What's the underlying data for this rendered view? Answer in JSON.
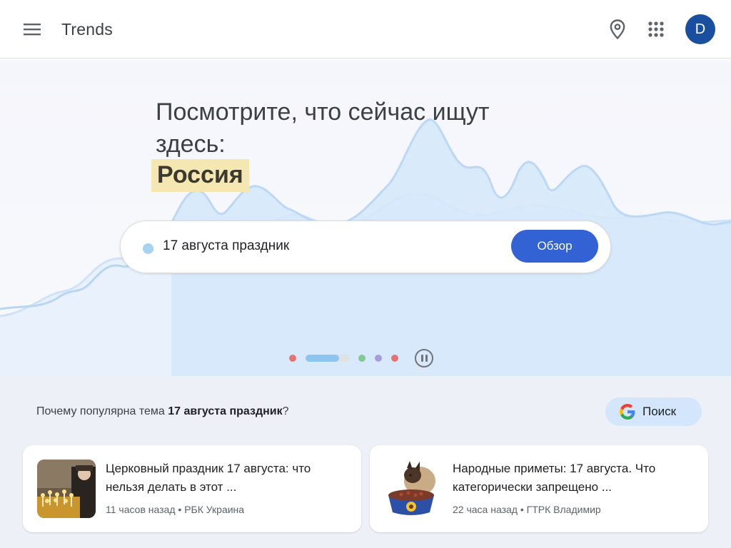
{
  "header": {
    "brand": "Trends",
    "avatar_letter": "D",
    "icons": [
      "menu-icon",
      "location-pin-icon",
      "apps-grid-icon"
    ]
  },
  "hero": {
    "headline": "Посмотрите, что сейчас ищут здесь:",
    "region": "Россия",
    "search_term": "17 августа праздник",
    "explore_label": "Обзор",
    "carousel": {
      "dots": [
        "#e57373",
        "progress",
        "#81c995",
        "#a69de0",
        "#e57373"
      ],
      "progress": 0.75,
      "pause_icon": "pause-icon"
    }
  },
  "related": {
    "question_prefix": "Почему популярна тема",
    "question_topic": "17 августа праздник",
    "question_suffix": "?",
    "search_button": "Поиск",
    "search_icon": "google-g-icon"
  },
  "articles": [
    {
      "title": "Церковный праздник 17 августа: что нельзя делать в этот ...",
      "time": "11 часов назад",
      "source": "РБК Украина",
      "image": "church-candles-photo"
    },
    {
      "title": "Народные приметы: 17 августа. Что категорически запрещено ...",
      "time": "22 часа назад",
      "source": "ГТРК Владимир",
      "image": "cat-with-food-bowl-photo"
    }
  ],
  "colors": {
    "accent": "#3262d4",
    "avatar": "#1a4fa0",
    "region_highlight": "#f5e7b1",
    "search_chip": "#d3e6fb"
  }
}
